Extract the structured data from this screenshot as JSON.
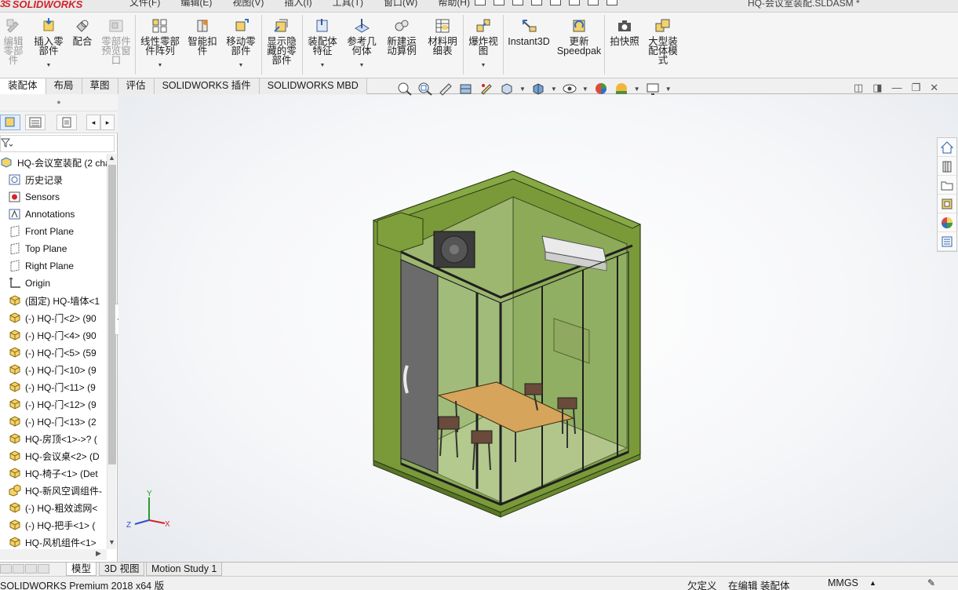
{
  "app": {
    "brand": "SOLIDWORKS",
    "menus": [
      "文件(F)",
      "编辑(E)",
      "视图(V)",
      "插入(I)",
      "工具(T)",
      "窗口(W)",
      "帮助(H)"
    ],
    "doc_title": "HQ-会议室装配.SLDASM *"
  },
  "ribbon": {
    "buttons": [
      {
        "label": "编辑零部件",
        "disabled": true,
        "icon": "edit-component-icon"
      },
      {
        "label": "插入零部件",
        "disabled": false,
        "icon": "insert-component-icon"
      },
      {
        "label": "配合",
        "disabled": false,
        "icon": "mate-icon"
      },
      {
        "label": "零部件预览窗口",
        "disabled": true,
        "icon": "component-preview-icon"
      },
      {
        "label": "线性零部件阵列",
        "disabled": false,
        "icon": "linear-pattern-icon"
      },
      {
        "label": "智能扣件",
        "disabled": false,
        "icon": "smart-fasteners-icon"
      },
      {
        "label": "移动零部件",
        "disabled": false,
        "icon": "move-component-icon"
      },
      {
        "label": "显示隐藏的零部件",
        "disabled": false,
        "icon": "show-hidden-icon"
      },
      {
        "label": "装配体特征",
        "disabled": false,
        "icon": "assembly-features-icon"
      },
      {
        "label": "参考几何体",
        "disabled": false,
        "icon": "reference-geometry-icon"
      },
      {
        "label": "新建运动算例",
        "disabled": false,
        "icon": "new-motion-study-icon"
      },
      {
        "label": "材料明细表",
        "disabled": false,
        "icon": "bom-icon"
      },
      {
        "label": "爆炸视图",
        "disabled": false,
        "icon": "exploded-view-icon"
      },
      {
        "label": "Instant3D",
        "disabled": false,
        "icon": "instant3d-icon"
      },
      {
        "label": "更新Speedpak",
        "disabled": false,
        "icon": "speedpak-icon"
      },
      {
        "label": "拍快照",
        "disabled": false,
        "icon": "snapshot-icon"
      },
      {
        "label": "大型装配体模式",
        "disabled": false,
        "icon": "large-assembly-icon"
      }
    ]
  },
  "tabs": [
    "装配体",
    "布局",
    "草图",
    "评估",
    "SOLIDWORKS 插件",
    "SOLIDWORKS MBD"
  ],
  "active_tab": "装配体",
  "tree": {
    "root": "HQ-会议室装配  (2 cha",
    "items": [
      {
        "label": "历史记录",
        "icon": "history-icon"
      },
      {
        "label": "Sensors",
        "icon": "sensors-icon"
      },
      {
        "label": "Annotations",
        "icon": "annotations-icon"
      },
      {
        "label": "Front Plane",
        "icon": "plane-icon"
      },
      {
        "label": "Top Plane",
        "icon": "plane-icon"
      },
      {
        "label": "Right Plane",
        "icon": "plane-icon"
      },
      {
        "label": "Origin",
        "icon": "origin-icon"
      },
      {
        "label": "(固定) HQ-墙体<1",
        "icon": "part-icon"
      },
      {
        "label": "(-) HQ-门<2> (90",
        "icon": "part-icon"
      },
      {
        "label": "(-) HQ-门<4> (90",
        "icon": "part-icon"
      },
      {
        "label": "(-) HQ-门<5> (59",
        "icon": "part-icon"
      },
      {
        "label": "(-) HQ-门<10> (9",
        "icon": "part-icon"
      },
      {
        "label": "(-) HQ-门<11> (9",
        "icon": "part-icon"
      },
      {
        "label": "(-) HQ-门<12> (9",
        "icon": "part-icon"
      },
      {
        "label": "(-) HQ-门<13> (2",
        "icon": "part-icon"
      },
      {
        "label": "HQ-房顶<1>->? (",
        "icon": "part-icon"
      },
      {
        "label": "HQ-会议桌<2> (D",
        "icon": "part-icon"
      },
      {
        "label": "HQ-椅子<1> (Det",
        "icon": "part-icon"
      },
      {
        "label": "HQ-新风空调组件-",
        "icon": "subassembly-icon"
      },
      {
        "label": "(-) HQ-粗效滤网<",
        "icon": "part-icon"
      },
      {
        "label": "(-) HQ-把手<1> (",
        "icon": "part-icon"
      },
      {
        "label": "HQ-风机组件<1>",
        "icon": "part-icon"
      }
    ]
  },
  "bottom_tabs": [
    "模型",
    "3D 视图",
    "Motion Study 1"
  ],
  "active_bottom_tab": "模型",
  "status": {
    "product": "SOLIDWORKS Premium 2018 x64 版",
    "definition": "欠定义",
    "editing": "在编辑 装配体",
    "units": "MMGS"
  },
  "triad": {
    "x": "X",
    "y": "Y",
    "z": "Z"
  }
}
